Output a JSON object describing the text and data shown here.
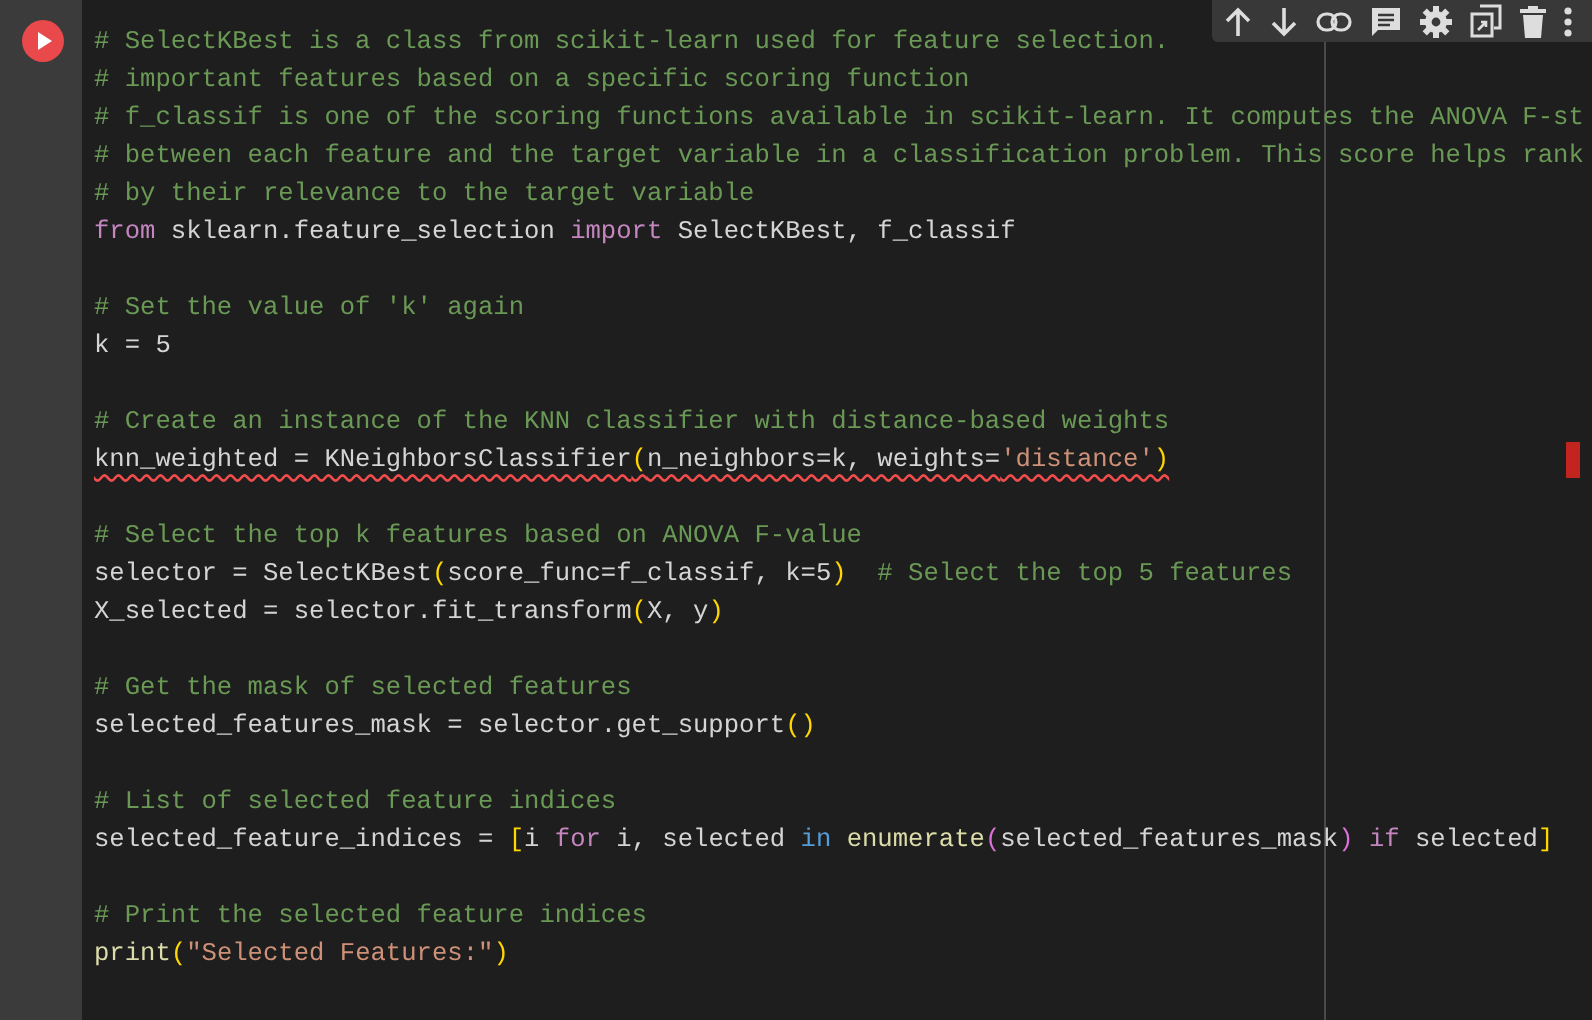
{
  "code_lines": [
    {
      "tokens": [
        {
          "kind": "comment",
          "text": "# SelectKBest is a class from scikit-learn used for feature selection."
        }
      ]
    },
    {
      "tokens": [
        {
          "kind": "comment",
          "text": "# important features based on a specific scoring function"
        }
      ]
    },
    {
      "tokens": [
        {
          "kind": "comment",
          "text": "# f_classif is one of the scoring functions available in scikit-learn. It computes the ANOVA F-st"
        }
      ]
    },
    {
      "tokens": [
        {
          "kind": "comment",
          "text": "# between each feature and the target variable in a classification problem. This score helps rank"
        }
      ]
    },
    {
      "tokens": [
        {
          "kind": "comment",
          "text": "# by their relevance to the target variable"
        }
      ]
    },
    {
      "tokens": [
        {
          "kind": "keyword",
          "text": "from"
        },
        {
          "kind": "plain",
          "text": " sklearn.feature_selection "
        },
        {
          "kind": "keyword",
          "text": "import"
        },
        {
          "kind": "plain",
          "text": " SelectKBest, f_classif"
        }
      ]
    },
    {
      "space_before": true,
      "tokens": [
        {
          "kind": "comment",
          "text": "# Set the value of 'k' again"
        }
      ]
    },
    {
      "tokens": [
        {
          "kind": "plain",
          "text": "k = 5"
        }
      ]
    },
    {
      "space_before": true,
      "tokens": [
        {
          "kind": "comment",
          "text": "# Create an instance of the KNN classifier with distance-based weights"
        }
      ]
    },
    {
      "error": true,
      "tokens": [
        {
          "kind": "plain",
          "text": "knn_weighted = KNeighborsClassifier"
        },
        {
          "kind": "bracket",
          "text": "("
        },
        {
          "kind": "plain",
          "text": "n_neighbors=k, weights="
        },
        {
          "kind": "string",
          "text": "'distance'"
        },
        {
          "kind": "bracket",
          "text": ")"
        }
      ]
    },
    {
      "space_before": true,
      "tokens": [
        {
          "kind": "comment",
          "text": "# Select the top k features based on ANOVA F-value"
        }
      ]
    },
    {
      "tokens": [
        {
          "kind": "plain",
          "text": "selector = SelectKBest"
        },
        {
          "kind": "bracket",
          "text": "("
        },
        {
          "kind": "plain",
          "text": "score_func=f_classif, k=5"
        },
        {
          "kind": "bracket",
          "text": ")"
        },
        {
          "kind": "comment",
          "text": "  # Select the top 5 features"
        }
      ]
    },
    {
      "tokens": [
        {
          "kind": "plain",
          "text": "X_selected = selector.fit_transform"
        },
        {
          "kind": "bracket",
          "text": "("
        },
        {
          "kind": "plain",
          "text": "X, y"
        },
        {
          "kind": "bracket",
          "text": ")"
        }
      ]
    },
    {
      "space_before": true,
      "tokens": [
        {
          "kind": "comment",
          "text": "# Get the mask of selected features"
        }
      ]
    },
    {
      "tokens": [
        {
          "kind": "plain",
          "text": "selected_features_mask = selector.get_support"
        },
        {
          "kind": "bracket",
          "text": "()"
        }
      ]
    },
    {
      "space_before": true,
      "tokens": [
        {
          "kind": "comment",
          "text": "# List of selected feature indices"
        }
      ]
    },
    {
      "tokens": [
        {
          "kind": "plain",
          "text": "selected_feature_indices = "
        },
        {
          "kind": "bracket",
          "text": "["
        },
        {
          "kind": "plain",
          "text": "i "
        },
        {
          "kind": "keyword",
          "text": "for"
        },
        {
          "kind": "plain",
          "text": " i, selected "
        },
        {
          "kind": "operator",
          "text": "in"
        },
        {
          "kind": "function",
          "text": " enumerate"
        },
        {
          "kind": "bracket2",
          "text": "("
        },
        {
          "kind": "plain",
          "text": "selected_features_mask"
        },
        {
          "kind": "bracket2",
          "text": ")"
        },
        {
          "kind": "keyword",
          "text": " if"
        },
        {
          "kind": "plain",
          "text": " selected"
        },
        {
          "kind": "bracket",
          "text": "]"
        }
      ]
    },
    {
      "space_before": true,
      "tokens": [
        {
          "kind": "comment",
          "text": "# Print the selected feature indices"
        }
      ]
    },
    {
      "tokens": [
        {
          "kind": "function",
          "text": "print"
        },
        {
          "kind": "bracket",
          "text": "("
        },
        {
          "kind": "string",
          "text": "\"Selected Features:\""
        },
        {
          "kind": "bracket",
          "text": ")"
        }
      ]
    }
  ]
}
